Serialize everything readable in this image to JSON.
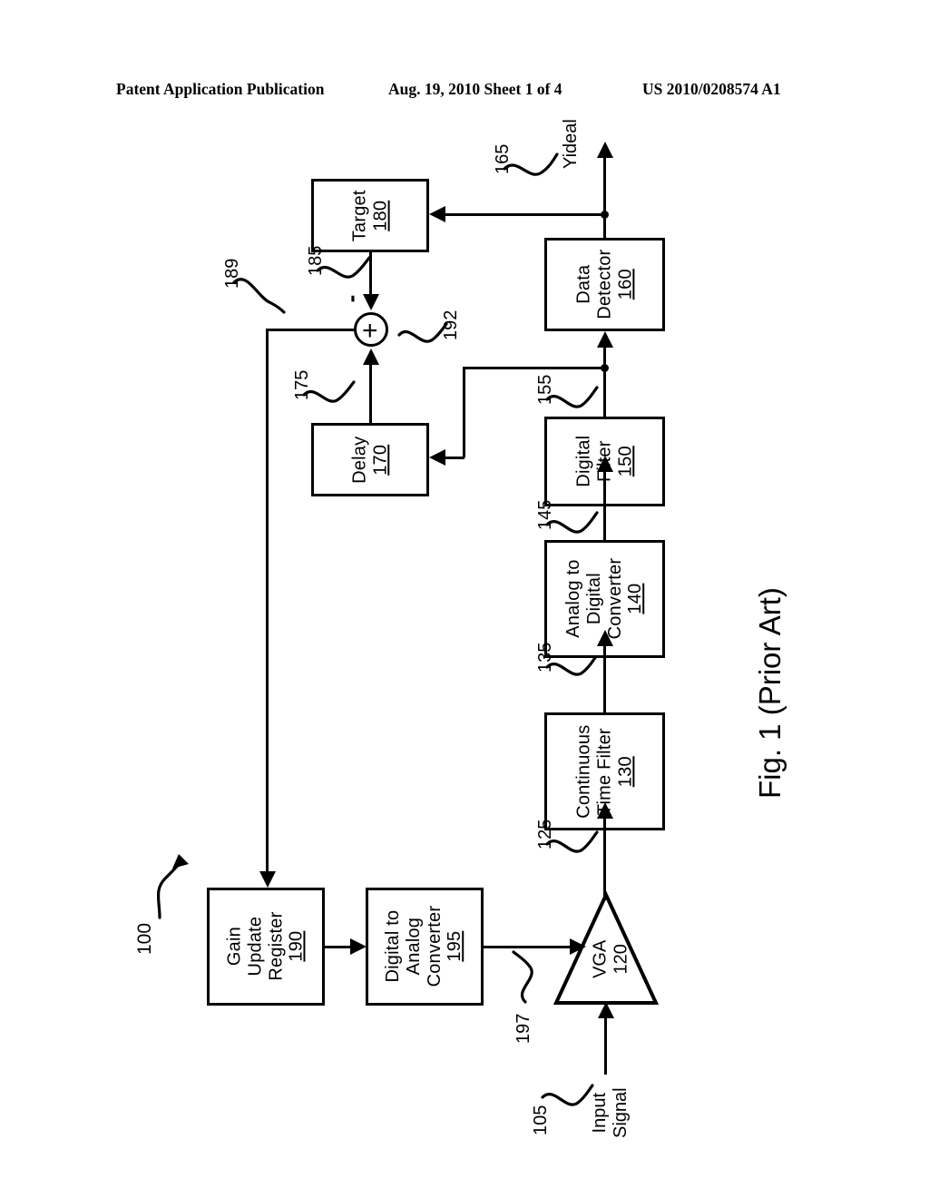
{
  "header": {
    "left": "Patent Application Publication",
    "middle": "Aug. 19, 2010  Sheet 1 of 4",
    "right": "US 2010/0208574 A1"
  },
  "figure": {
    "caption": "Fig. 1 (Prior Art)",
    "system_ref": "100"
  },
  "blocks": {
    "target": {
      "title": "Target",
      "ref": "180"
    },
    "delay": {
      "title": "Delay",
      "ref": "170"
    },
    "data_detector": {
      "line1": "Data",
      "line2": "Detector",
      "ref": "160"
    },
    "digital_filter": {
      "line1": "Digital",
      "line2": "Filter",
      "ref": "150"
    },
    "adc": {
      "line1": "Analog to",
      "line2": "Digital",
      "line3": "Converter",
      "ref": "140"
    },
    "ctf": {
      "line1": "Continuous",
      "line2": "Time Filter",
      "ref": "130"
    },
    "vga": {
      "title": "VGA",
      "ref": "120"
    },
    "gain_update_register": {
      "line1": "Gain",
      "line2": "Update",
      "line3": "Register",
      "ref": "190"
    },
    "dac": {
      "line1": "Digital to",
      "line2": "Analog",
      "line3": "Converter",
      "ref": "195"
    }
  },
  "signals": {
    "input_signal": {
      "label": "Input Signal",
      "ref": "105"
    },
    "yideal": {
      "label": "Yideal",
      "ref": "165"
    },
    "s125": "125",
    "s135": "135",
    "s145": "145",
    "s155": "155",
    "s175": "175",
    "s185": "185",
    "s189": "189",
    "s192": "192",
    "s197": "197"
  },
  "summing_node": {
    "plus": "+",
    "minus": "-"
  },
  "colors": {
    "ink": "#000000",
    "paper": "#ffffff"
  }
}
